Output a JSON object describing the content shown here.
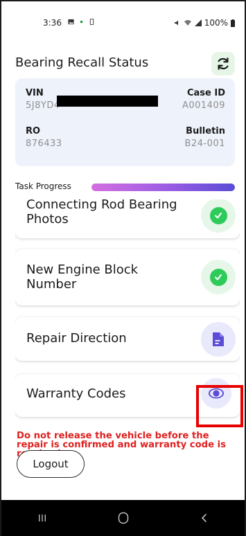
{
  "status_bar": {
    "time": "3:36",
    "battery": "100%"
  },
  "header": {
    "title": "Bearing Recall Status"
  },
  "info": {
    "vin_label": "VIN",
    "vin_value": "5J8YD4",
    "case_label": "Case ID",
    "case_value": "A001409",
    "ro_label": "RO",
    "ro_value": "876433",
    "bulletin_label": "Bulletin",
    "bulletin_value": "B24-001"
  },
  "progress": {
    "label": "Task Progress",
    "fraction": 1.0
  },
  "tasks": [
    {
      "label": "Connecting Rod Bearing Photos",
      "status": "complete",
      "icon": "check-icon"
    },
    {
      "label": "New Engine Block Number",
      "status": "complete",
      "icon": "check-icon"
    },
    {
      "label": "Repair Direction",
      "status": "document",
      "icon": "document-icon"
    },
    {
      "label": "Warranty Codes",
      "status": "view",
      "icon": "eye-icon"
    }
  ],
  "warning": "Do not release the vehicle before the repair is confirmed and warranty code is received.",
  "logout_label": "Logout",
  "colors": {
    "accent_green": "#2ecb5a",
    "accent_purple": "#5b4cd6",
    "warning_red": "#e02020",
    "highlight_red": "#e80000"
  }
}
